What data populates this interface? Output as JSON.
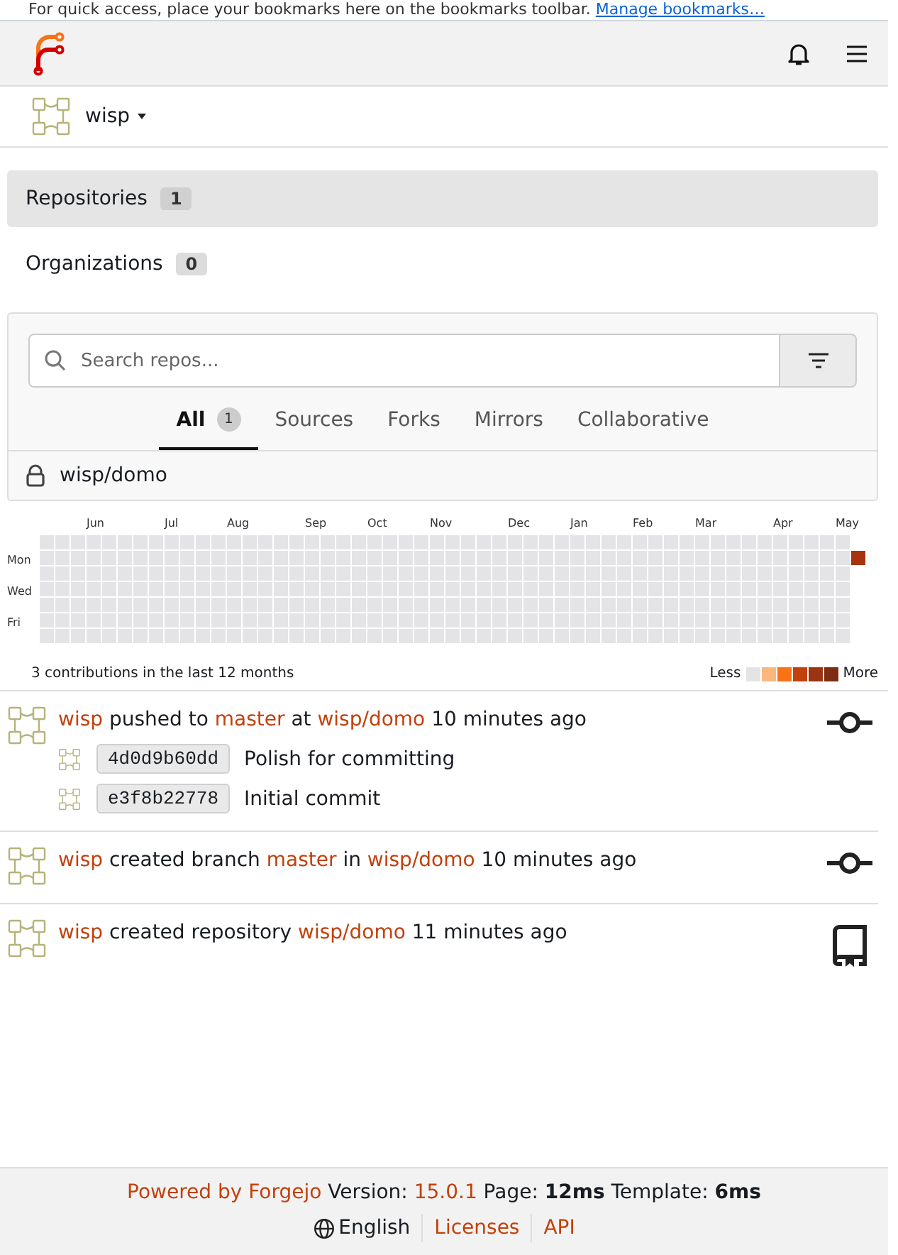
{
  "browser_bookmarks_bar": {
    "message": "For quick access, place your bookmarks here on the bookmarks toolbar.",
    "link": "Manage bookmarks…"
  },
  "user_menu": {
    "username": "wisp"
  },
  "dashboard_menu": [
    {
      "label": "Repositories",
      "count": "1",
      "selected": true
    },
    {
      "label": "Organizations",
      "count": "0",
      "selected": false
    }
  ],
  "repo_panel": {
    "search": {
      "placeholder": "Search repos..."
    },
    "tabs": [
      {
        "label": "All",
        "count": "1",
        "selected": true
      },
      {
        "label": "Sources",
        "selected": false
      },
      {
        "label": "Forks",
        "selected": false
      },
      {
        "label": "Mirrors",
        "selected": false
      },
      {
        "label": "Collaborative",
        "selected": false
      }
    ],
    "repos": [
      {
        "name": "wisp/domo",
        "private": true
      }
    ]
  },
  "heatmap": {
    "months": [
      "Jun",
      "Jul",
      "Aug",
      "Sep",
      "Oct",
      "Nov",
      "Dec",
      "Jan",
      "Feb",
      "Mar",
      "Apr",
      "May"
    ],
    "weekdays": [
      "Mon",
      "Wed",
      "Fri"
    ],
    "latest_week": [
      {
        "color": "#a8330f"
      }
    ],
    "summary": "3 contributions in the last 12 months",
    "legend_less": "Less",
    "legend": [
      {
        "color": "#e4e4e7"
      },
      {
        "color": "#fbb77e"
      },
      {
        "color": "#f97316"
      },
      {
        "color": "#c2410c"
      },
      {
        "color": "#9a3412"
      },
      {
        "color": "#7c2d12"
      }
    ],
    "legend_more": "More"
  },
  "feed": [
    {
      "kind": "push",
      "segments": [
        {
          "text": "wisp",
          "kind": "link"
        },
        {
          "text": " pushed to ",
          "kind": "text"
        },
        {
          "text": "master",
          "kind": "link"
        },
        {
          "text": " at ",
          "kind": "text"
        },
        {
          "text": "wisp/domo",
          "kind": "link"
        },
        {
          "text": " 10 minutes ago",
          "kind": "text"
        }
      ],
      "commits": [
        {
          "sha": "4d0d9b60dd",
          "message": "Polish for committing"
        },
        {
          "sha": "e3f8b22778",
          "message": "Initial commit"
        }
      ]
    },
    {
      "kind": "create_branch",
      "segments": [
        {
          "text": "wisp",
          "kind": "link"
        },
        {
          "text": " created branch ",
          "kind": "text"
        },
        {
          "text": "master",
          "kind": "link"
        },
        {
          "text": " in ",
          "kind": "text"
        },
        {
          "text": "wisp/domo",
          "kind": "link"
        },
        {
          "text": " 10 minutes ago",
          "kind": "text"
        }
      ]
    },
    {
      "kind": "create_repo",
      "segments": [
        {
          "text": "wisp",
          "kind": "link"
        },
        {
          "text": " created repository ",
          "kind": "text"
        },
        {
          "text": "wisp/domo",
          "kind": "link"
        },
        {
          "text": " 11 minutes ago",
          "kind": "text"
        }
      ]
    }
  ],
  "footer": {
    "segments": [
      {
        "text": "Powered by Forgejo",
        "kind": "link"
      },
      {
        "text": " Version: ",
        "kind": "text"
      },
      {
        "text": "15.0.1",
        "kind": "link"
      },
      {
        "text": " Page: ",
        "kind": "text"
      },
      {
        "text": "12ms",
        "kind": "bold"
      },
      {
        "text": " Template: ",
        "kind": "text"
      },
      {
        "text": "6ms",
        "kind": "bold"
      }
    ],
    "language": "English",
    "links": [
      "Licenses",
      "API"
    ]
  }
}
